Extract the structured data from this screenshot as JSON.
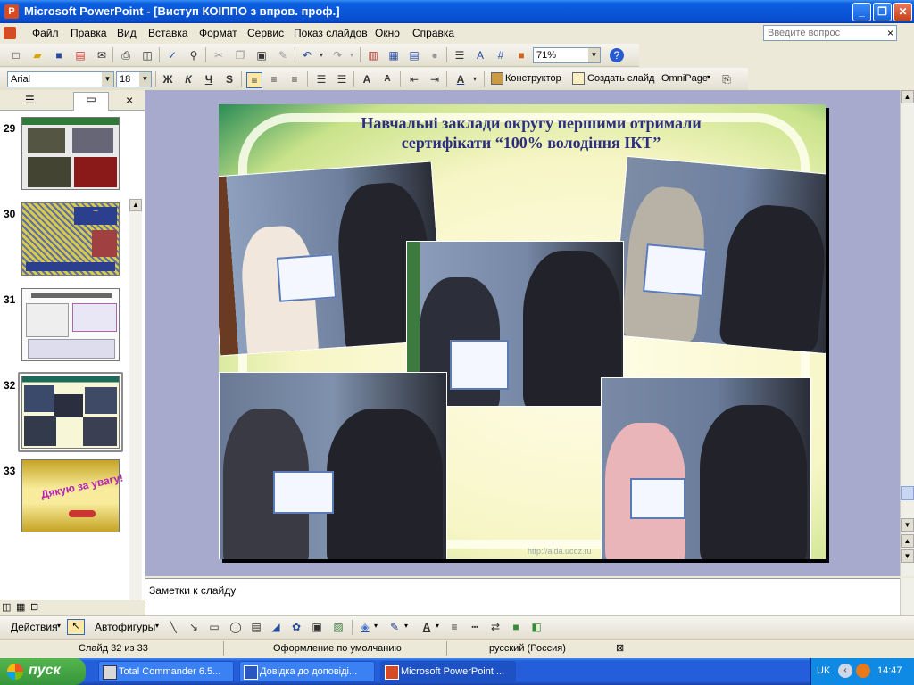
{
  "window": {
    "title": "Microsoft PowerPoint - [Виступ КОІППО з впров. проф.]",
    "min_label": "_",
    "max_label": "❐",
    "close_label": "✕"
  },
  "menu": {
    "items": [
      "Файл",
      "Правка",
      "Вид",
      "Вставка",
      "Формат",
      "Сервис",
      "Показ слайдов",
      "Окно",
      "Справка"
    ],
    "ask_placeholder": "Введите вопрос",
    "close_doc": "×"
  },
  "toolbar_standard": {
    "zoom": "71%"
  },
  "toolbar_format": {
    "font": "Arial",
    "size": "18",
    "bold": "Ж",
    "italic": "К",
    "underline": "Ч",
    "shadow": "S",
    "design_label": "Конструктор",
    "new_slide_label": "Создать слайд",
    "omnipage_label": "OmniPage"
  },
  "thumbnails": [
    {
      "num": "29",
      "selected": false
    },
    {
      "num": "30",
      "selected": false
    },
    {
      "num": "31",
      "selected": false
    },
    {
      "num": "32",
      "selected": true
    },
    {
      "num": "33",
      "selected": false,
      "text": "Дякую за увагу!"
    }
  ],
  "slide": {
    "title_line1": "Навчальні заклади округу першими отримали",
    "title_line2": "сертифікати “100% володіння ІКТ”",
    "watermark": "http://aida.ucoz.ru"
  },
  "notes": {
    "placeholder": "Заметки к слайду"
  },
  "drawbar": {
    "actions_label": "Действия",
    "autoshapes_label": "Автофигуры"
  },
  "status": {
    "slide": "Слайд 32 из 33",
    "design": "Оформление по умолчанию",
    "language": "русский (Россия)"
  },
  "taskbar": {
    "start": "пуск",
    "items": [
      "Total Commander 6.5...",
      "Довідка до доповіді...",
      "Microsoft PowerPoint ..."
    ],
    "lang": "UK",
    "time": "14:47"
  },
  "colors": {
    "title_text": "#2c2f7e",
    "titlebar": "#0a55d6",
    "slide_bg": "#a7aacd"
  }
}
